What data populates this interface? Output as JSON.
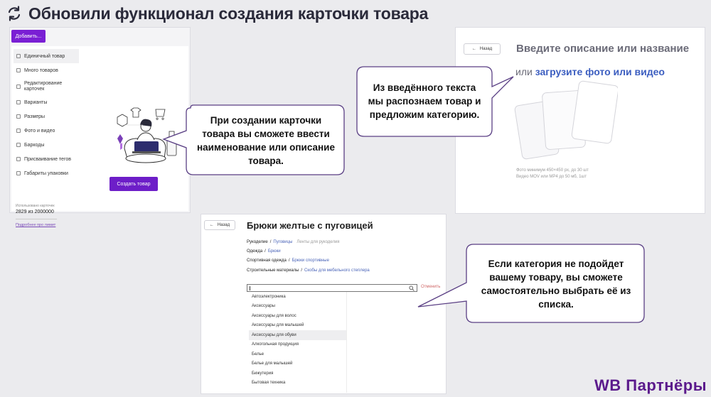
{
  "header": {
    "title": "Обновили функционал создания карточки товара"
  },
  "panel_create": {
    "add_button": "Добавить...",
    "menu": [
      {
        "label": "Единичный товар",
        "icon": "box-icon"
      },
      {
        "label": "Много товаров",
        "icon": "grid-icon"
      },
      {
        "label": "Редактирование карточек",
        "icon": "pencil-icon"
      },
      {
        "label": "Варианты",
        "icon": "variants-icon"
      },
      {
        "label": "Размеры",
        "icon": "ruler-icon"
      },
      {
        "label": "Фото и видео",
        "icon": "camera-icon"
      },
      {
        "label": "Баркоды",
        "icon": "barcode-icon"
      },
      {
        "label": "Присваивание тегов",
        "icon": "tag-icon"
      },
      {
        "label": "Габариты упаковки",
        "icon": "package-icon"
      }
    ],
    "limit_label": "Использовано карточек",
    "limit_value": "2829 из 2000000",
    "limit_link": "Подробнее про лимит",
    "create_button": "Создать товар"
  },
  "panel_describe": {
    "back_label": "Назад",
    "line1": "Введите описание или название",
    "line2_prefix": "или",
    "line2_link": "загрузите фото или видео",
    "hint1": "Фото минимум 450×450 px, до 30 шт",
    "hint2": "Видео MOV или MP4 до 50 мб, 1шт"
  },
  "panel_category": {
    "back_label": "Назад",
    "title": "Брюки желтые с пуговицей",
    "suggestions": [
      {
        "parent": "Рукоделие",
        "child": "Пуговицы",
        "extra": "Ленты для рукоделия"
      },
      {
        "parent": "Одежда",
        "child": "Брюки",
        "extra": ""
      },
      {
        "parent": "Спортивная одежда",
        "child": "Брюки спортивные",
        "extra": ""
      },
      {
        "parent": "Строительные материалы",
        "child": "Скобы для мебельного степлера",
        "extra": ""
      }
    ],
    "cancel_label": "Отменить",
    "categories": [
      "Автоэлектроника",
      "Аксессуары",
      "Аксессуары для волос",
      "Аксессуары для малышей",
      "Аксессуары для обуви",
      "Алкогольная продукция",
      "Белье",
      "Белье для малышей",
      "Бижутерия",
      "Бытовая техника"
    ]
  },
  "bubbles": {
    "create": [
      "При создании карточки",
      "товара вы сможете ввести",
      "наименование или описание",
      "товара."
    ],
    "recognize": [
      "Из введённого текста",
      "мы распознаем товар и",
      "предложим категорию."
    ],
    "choose": [
      "Если категория не подойдет",
      "вашему товару, вы сможете",
      "самостоятельно выбрать её из",
      "списка."
    ]
  },
  "brand": "WB Партнёры",
  "colors": {
    "accent": "#6d1ec8",
    "brand": "#5b1a8c",
    "link": "#3c5ec0",
    "bubble_border": "#5a3f84"
  }
}
